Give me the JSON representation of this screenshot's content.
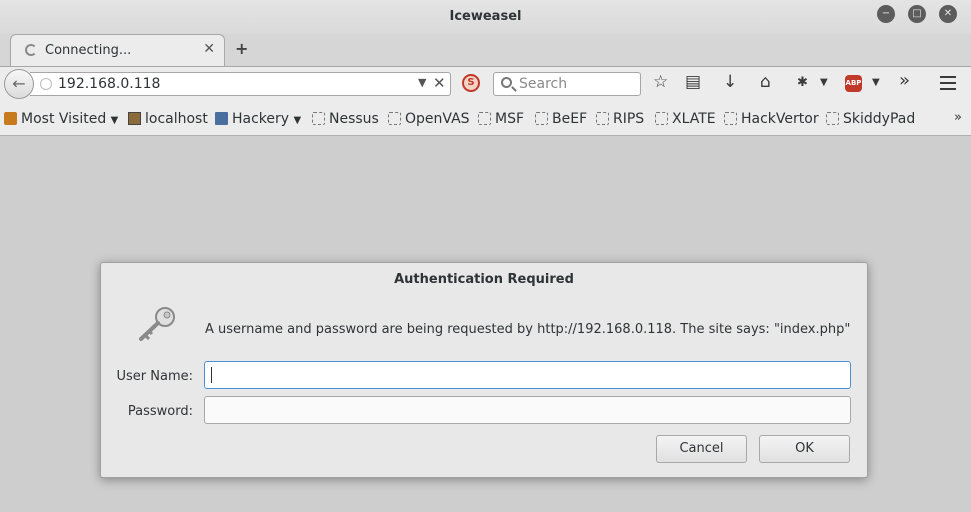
{
  "window": {
    "title": "Iceweasel"
  },
  "tab": {
    "title": "Connecting..."
  },
  "urlbar": {
    "url": "192.168.0.118"
  },
  "search": {
    "placeholder": "Search"
  },
  "addons": {
    "adblock_label": "ABP"
  },
  "bookmarks": [
    {
      "label": "Most Visited",
      "icon": "most-visited-icon",
      "dropdown": true
    },
    {
      "label": "localhost",
      "icon": "localhost-icon",
      "dropdown": false
    },
    {
      "label": "Hackery",
      "icon": "folder-icon",
      "dropdown": true
    },
    {
      "label": "Nessus",
      "icon": "page-icon",
      "dropdown": false
    },
    {
      "label": "OpenVAS",
      "icon": "page-icon",
      "dropdown": false
    },
    {
      "label": "MSF",
      "icon": "page-icon",
      "dropdown": false
    },
    {
      "label": "BeEF",
      "icon": "page-icon",
      "dropdown": false
    },
    {
      "label": "RIPS",
      "icon": "page-icon",
      "dropdown": false
    },
    {
      "label": "XLATE",
      "icon": "page-icon",
      "dropdown": false
    },
    {
      "label": "HackVertor",
      "icon": "page-icon",
      "dropdown": false
    },
    {
      "label": "SkiddyPad",
      "icon": "page-icon",
      "dropdown": false
    }
  ],
  "dialog": {
    "title": "Authentication Required",
    "message": "A username and password are being requested by http://192.168.0.118. The site says: \"index.php\"",
    "username_label": "User Name:",
    "password_label": "Password:",
    "username_value": "",
    "password_value": "",
    "cancel_label": "Cancel",
    "ok_label": "OK"
  },
  "colors": {
    "focus_ring": "#4a90d9",
    "noscript": "#c0392b",
    "adblock": "#c0392b"
  }
}
